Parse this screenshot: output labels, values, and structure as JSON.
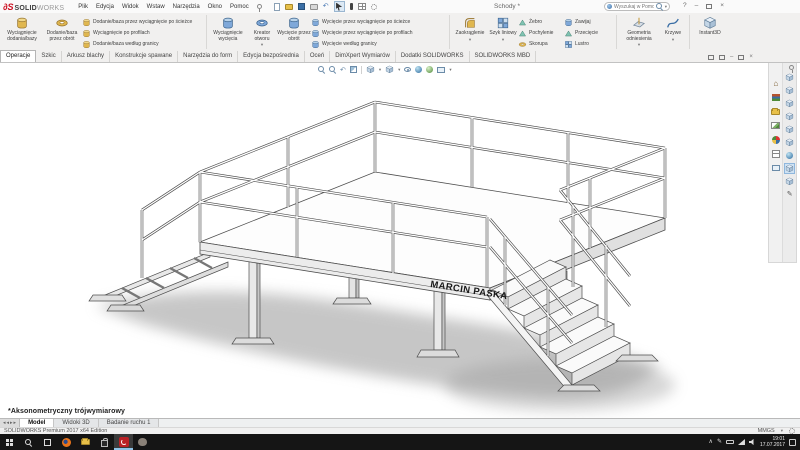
{
  "window": {
    "brand_bold": "SOLID",
    "brand_light": "WORKS",
    "brand_glyph": "∂S",
    "document_title": "Schody *",
    "menus": [
      "Plik",
      "Edycja",
      "Widok",
      "Wstaw",
      "Narzędzia",
      "Okno",
      "Pomoc"
    ],
    "search_placeholder": "Wyszukaj w Pomocy SOLIDWORKS",
    "help_label": "?"
  },
  "ribbon": {
    "g0": {
      "big": [
        "Wyciągnięcie dodania/bazy",
        "Dodanie/baza przez obrót"
      ],
      "stack": [
        "Dodanie/baza przez wyciągnięcie po ścieżce",
        "Wyciągnięcie po profilach",
        "Dodanie/baza według granicy"
      ]
    },
    "g1": {
      "big": [
        "Wyciągnięcie wycięcia",
        "Kreator otworu",
        "Wycięcie przez obrót"
      ],
      "stack": [
        "Wycięcie przez wyciągnięcie po ścieżce",
        "Wycięcie przez wyciągnięcie po profilach",
        "Wycięcie według granicy"
      ]
    },
    "g2": {
      "big": [
        "Zaokrąglenie",
        "Szyk liniowy"
      ],
      "stackA": [
        "Żebro",
        "Pochylenie",
        "Skorupa"
      ],
      "stackB": [
        "Zawijaj",
        "Przecięcie",
        "Lustro"
      ]
    },
    "g3": {
      "big": [
        "Geometria odniesienia",
        "Krzywe"
      ]
    },
    "g4": {
      "big": [
        "Instant3D"
      ]
    }
  },
  "command_tabs": {
    "items": [
      "Operacje",
      "Szkic",
      "Arkusz blachy",
      "Konstrukcje spawane",
      "Narzędzia do form",
      "Edycja bezpośrednia",
      "Oceń",
      "DimXpert Wymiarów",
      "Dodatki SOLIDWORKS",
      "SOLIDWORKS MBD"
    ],
    "active": "Operacje"
  },
  "viewport": {
    "orientation_label": "*Aksonometryczny trójwymiarowy",
    "model_text": "MARCIN PASKA"
  },
  "model_tabs": {
    "items": [
      "Model",
      "Widoki 3D",
      "Badanie ruchu 1"
    ],
    "active": "Model"
  },
  "status_bar": {
    "edition": "SOLIDWORKS Premium 2017 x64 Edition",
    "units": "MMGS"
  },
  "taskbar": {
    "time": "19:01",
    "date": "17.07.2017"
  },
  "icons": {
    "dropdown": "▾",
    "close": "×",
    "minimize": "–",
    "help": "?",
    "undo": "↶",
    "pencil": "✎",
    "tray_chevron": "∧",
    "scroll_left": "◂",
    "scroll_right": "▸",
    "home": "⌂"
  },
  "colors": {
    "accent_red": "#cb0e20",
    "ribbon_bg": "#f1f0ef",
    "taskbar_bg": "#151515",
    "selection_blue": "#cfe2f3"
  }
}
